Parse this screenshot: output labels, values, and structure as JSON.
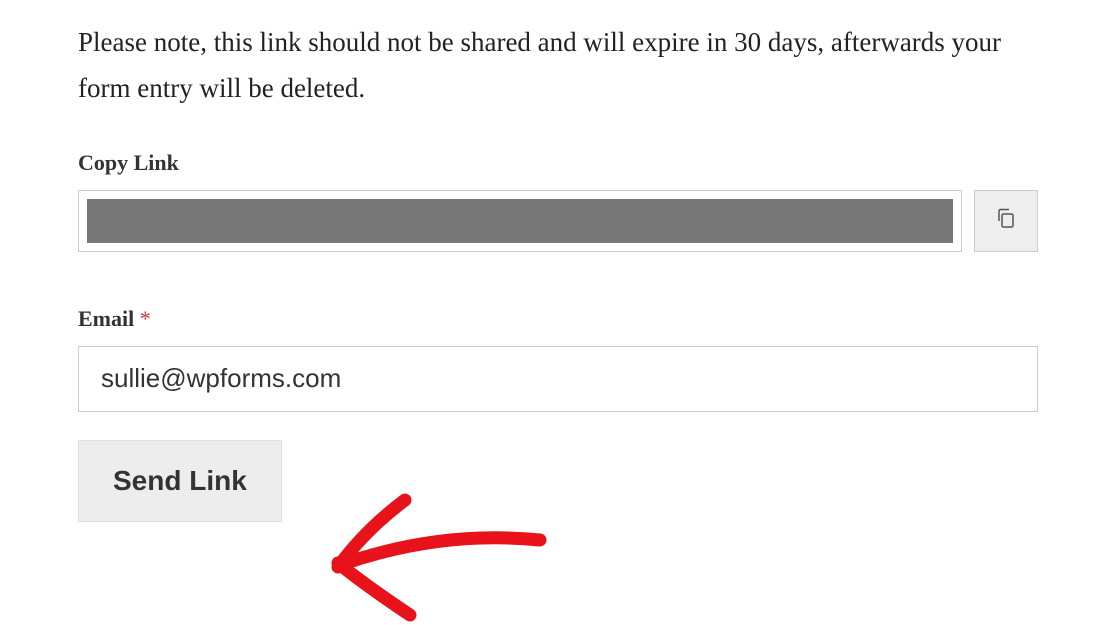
{
  "notice": "Please note, this link should not be shared and will expire in 30 days, afterwards your form entry will be deleted.",
  "copyLink": {
    "label": "Copy Link"
  },
  "email": {
    "label": "Email",
    "required": "*",
    "value": "sullie@wpforms.com"
  },
  "sendButton": {
    "label": "Send Link"
  }
}
